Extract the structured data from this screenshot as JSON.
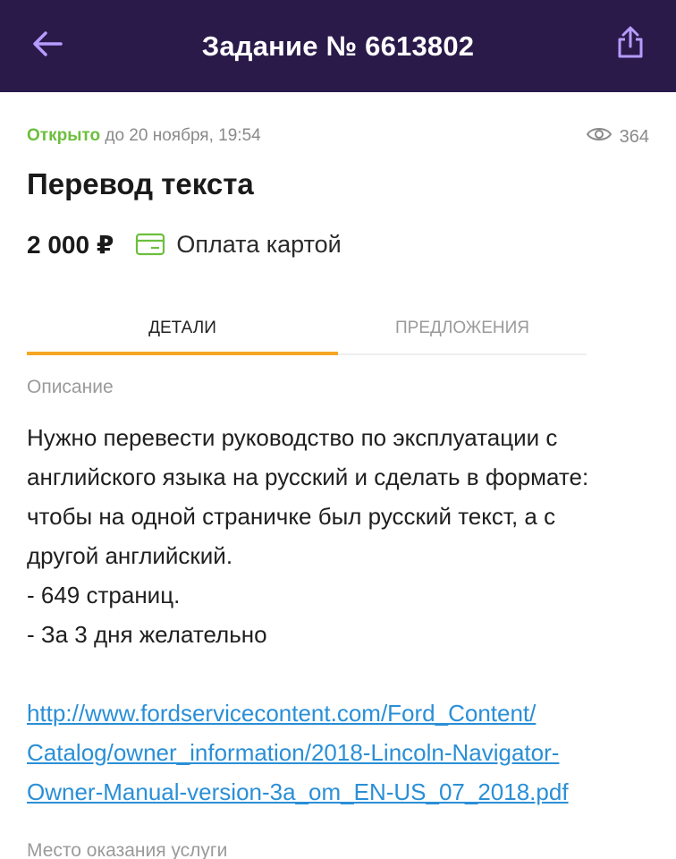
{
  "header": {
    "title": "Задание № 6613802",
    "back_icon": "arrow-left-icon",
    "share_icon": "share-icon"
  },
  "task": {
    "status": "Открыто",
    "deadline": "до 20 ноября, 19:54",
    "views": "364",
    "title": "Перевод текста",
    "price": "2 000 ₽",
    "payment": "Оплата картой"
  },
  "tabs": {
    "details": "ДЕТАЛИ",
    "offers": "ПРЕДЛОЖЕНИЯ",
    "active": "details"
  },
  "description": {
    "label": "Описание",
    "lines": [
      "Нужно перевести руководство по эксплуатации с",
      "английского языка на русский и сделать в формате:",
      "чтобы на одной страничке был русский текст, а с",
      "другой английский.",
      "- 649 страниц.",
      "- За 3 дня желательно"
    ],
    "link_lines": [
      "http://www.fordservicecontent.com/Ford_Content/",
      "Catalog/owner_information/2018-Lincoln-Navigator-",
      "Owner-Manual-version-3a_om_EN-US_07_2018.pdf"
    ]
  },
  "place": {
    "label": "Место оказания услуги"
  },
  "colors": {
    "header_bg": "#2a1a4a",
    "header_icon": "#b69cff",
    "status_open": "#6cbf3c",
    "tab_indicator": "#f5a623",
    "link": "#2a8fd6",
    "card_icon": "#6cbf3c"
  }
}
